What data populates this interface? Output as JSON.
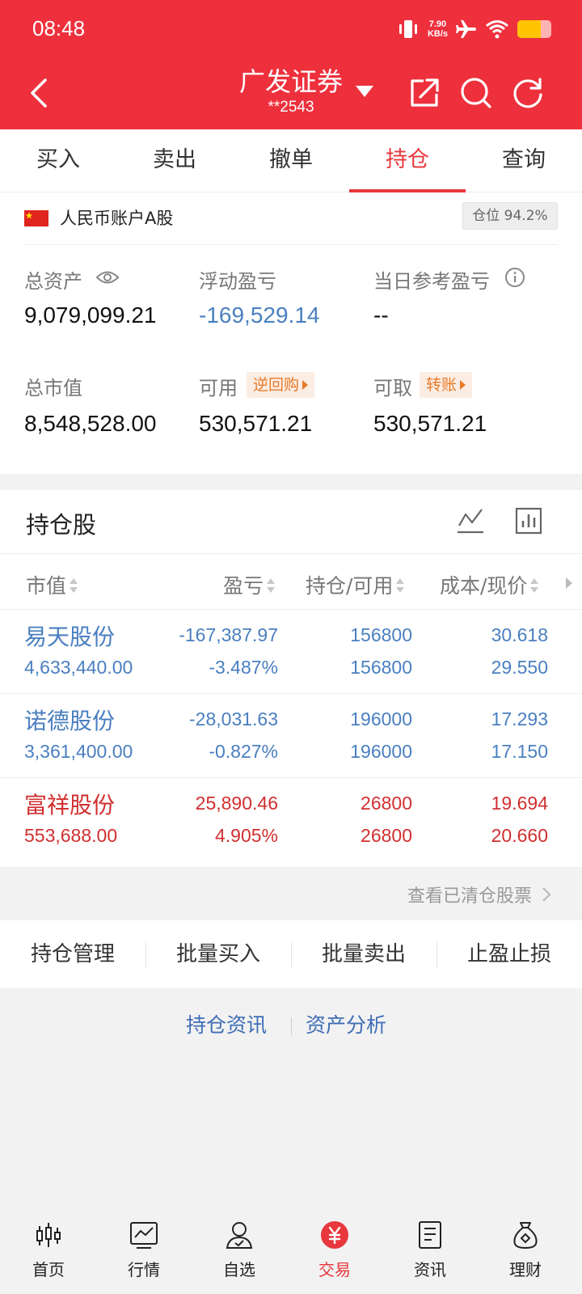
{
  "status_bar": {
    "time": "08:48",
    "speed_value": "7.90",
    "speed_unit": "KB/s",
    "battery_level": 0.68
  },
  "header": {
    "title": "广发证券",
    "account": "**2543"
  },
  "tabs": [
    {
      "label": "买入",
      "active": false
    },
    {
      "label": "卖出",
      "active": false
    },
    {
      "label": "撤单",
      "active": false
    },
    {
      "label": "持仓",
      "active": true
    },
    {
      "label": "查询",
      "active": false
    }
  ],
  "account": {
    "name": "人民币账户A股",
    "position_badge": "仓位 94.2%",
    "total_assets_label": "总资产",
    "total_assets": "9,079,099.21",
    "floating_pl_label": "浮动盈亏",
    "floating_pl": "-169,529.14",
    "daily_pl_label": "当日参考盈亏",
    "daily_pl": "--",
    "market_value_label": "总市值",
    "market_value": "8,548,528.00",
    "available_label": "可用",
    "available_tag": "逆回购",
    "available": "530,571.21",
    "withdrawable_label": "可取",
    "withdrawable_tag": "转账",
    "withdrawable": "530,571.21"
  },
  "holdings": {
    "title": "持仓股",
    "columns": [
      "市值",
      "盈亏",
      "持仓/可用",
      "成本/现价"
    ],
    "rows": [
      {
        "name": "易天股份",
        "market_value": "4,633,440.00",
        "pl": "-167,387.97",
        "pl_pct": "-3.487%",
        "position": "156800",
        "available": "156800",
        "cost": "30.618",
        "price": "29.550",
        "color": "#4a7fc0"
      },
      {
        "name": "诺德股份",
        "market_value": "3,361,400.00",
        "pl": "-28,031.63",
        "pl_pct": "-0.827%",
        "position": "196000",
        "available": "196000",
        "cost": "17.293",
        "price": "17.150",
        "color": "#4a7fc0"
      },
      {
        "name": "富祥股份",
        "market_value": "553,688.00",
        "pl": "25,890.46",
        "pl_pct": "4.905%",
        "position": "26800",
        "available": "26800",
        "cost": "19.694",
        "price": "20.660",
        "color": "#d12f2f"
      }
    ],
    "cleared_link": "查看已清仓股票"
  },
  "actions": [
    "持仓管理",
    "批量买入",
    "批量卖出",
    "止盈止损"
  ],
  "links": [
    "持仓资讯",
    "资产分析"
  ],
  "bottom_nav": [
    {
      "label": "首页",
      "icon": "candlestick-icon",
      "active": false
    },
    {
      "label": "行情",
      "icon": "market-chart-icon",
      "active": false
    },
    {
      "label": "自选",
      "icon": "user-check-icon",
      "active": false
    },
    {
      "label": "交易",
      "icon": "yuan-icon",
      "active": true
    },
    {
      "label": "资讯",
      "icon": "document-icon",
      "active": false
    },
    {
      "label": "理财",
      "icon": "money-bag-icon",
      "active": false
    }
  ],
  "colors": {
    "brand_red": "#ee303d",
    "tab_active": "#e8383d",
    "loss_blue": "#4a7fc0",
    "gain_red": "#d12f2f",
    "tag_orange": "#e87a2a"
  }
}
